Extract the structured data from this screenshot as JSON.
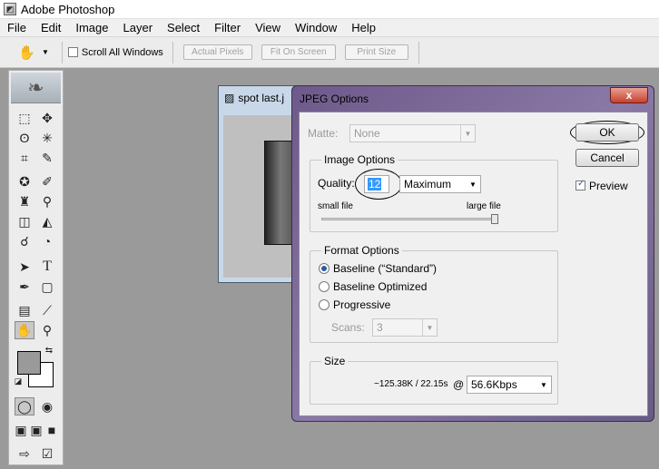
{
  "app": {
    "title": "Adobe Photoshop"
  },
  "menu": [
    "File",
    "Edit",
    "Image",
    "Layer",
    "Select",
    "Filter",
    "View",
    "Window",
    "Help"
  ],
  "options": {
    "scroll_all_label": "Scroll All Windows",
    "scroll_all_checked": false,
    "actual_pixels": "Actual Pixels",
    "fit_on_screen": "Fit On Screen",
    "print_size": "Print Size"
  },
  "document": {
    "title": "spot last.j"
  },
  "dialog": {
    "title": "JPEG Options",
    "close": "x",
    "matte_label": "Matte:",
    "matte_value": "None",
    "image_options_label": "Image Options",
    "quality_label": "Quality:",
    "quality_value": "12",
    "quality_preset": "Maximum",
    "small_file": "small file",
    "large_file": "large file",
    "quality_fraction": 1.0,
    "format_options_label": "Format Options",
    "baseline_standard": "Baseline (“Standard”)",
    "baseline_optimized": "Baseline Optimized",
    "progressive": "Progressive",
    "selected_format": "baseline_standard",
    "scans_label": "Scans:",
    "scans_value": "3",
    "size_label": "Size",
    "size_estimate": "~125.38K / 22.15s",
    "at": "@",
    "speed_value": "56.6Kbps",
    "ok": "OK",
    "cancel": "Cancel",
    "preview": "Preview",
    "preview_checked": true
  },
  "colors": {
    "accent": "#2a5aa8",
    "selection": "#3399ff"
  }
}
